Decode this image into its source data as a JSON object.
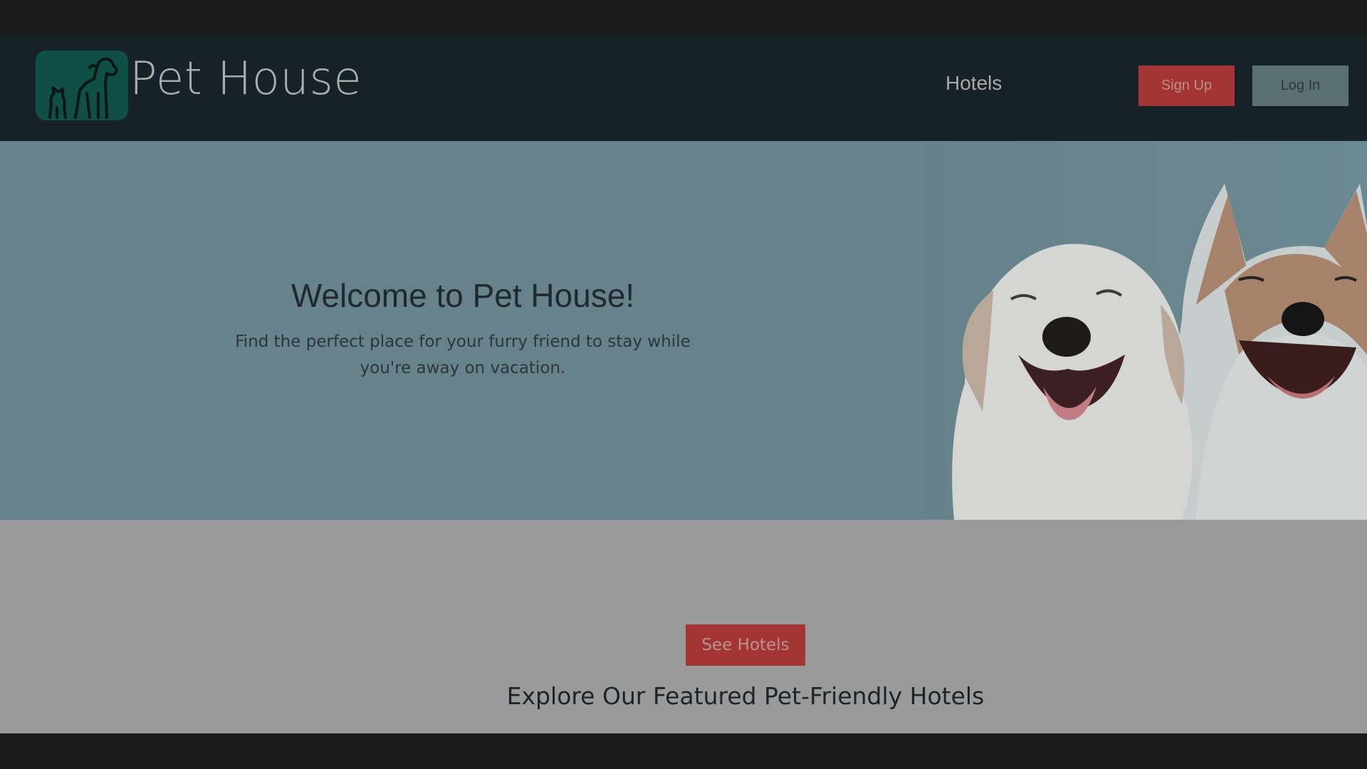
{
  "brand": {
    "name": "Pet House",
    "logo_icon": "dog-and-cat-icon"
  },
  "nav": {
    "hotels_label": "Hotels",
    "signup_label": "Sign Up",
    "login_label": "Log In"
  },
  "hero": {
    "title": "Welcome to Pet House!",
    "subtitle": "Find the perfect place for your furry friend to stay while you're away on vacation.",
    "image_icon": "smiling-dogs-photo"
  },
  "featured": {
    "button_label": "See Hotels",
    "heading": "Explore Our Featured Pet-Friendly Hotels"
  },
  "colors": {
    "navbar_bg": "#172128",
    "accent_red": "#a33535",
    "login_bg": "#5a6f71",
    "hero_bg": "#67828a",
    "section_bg": "#9a9a9a",
    "logo_bg": "#0f4f45"
  }
}
